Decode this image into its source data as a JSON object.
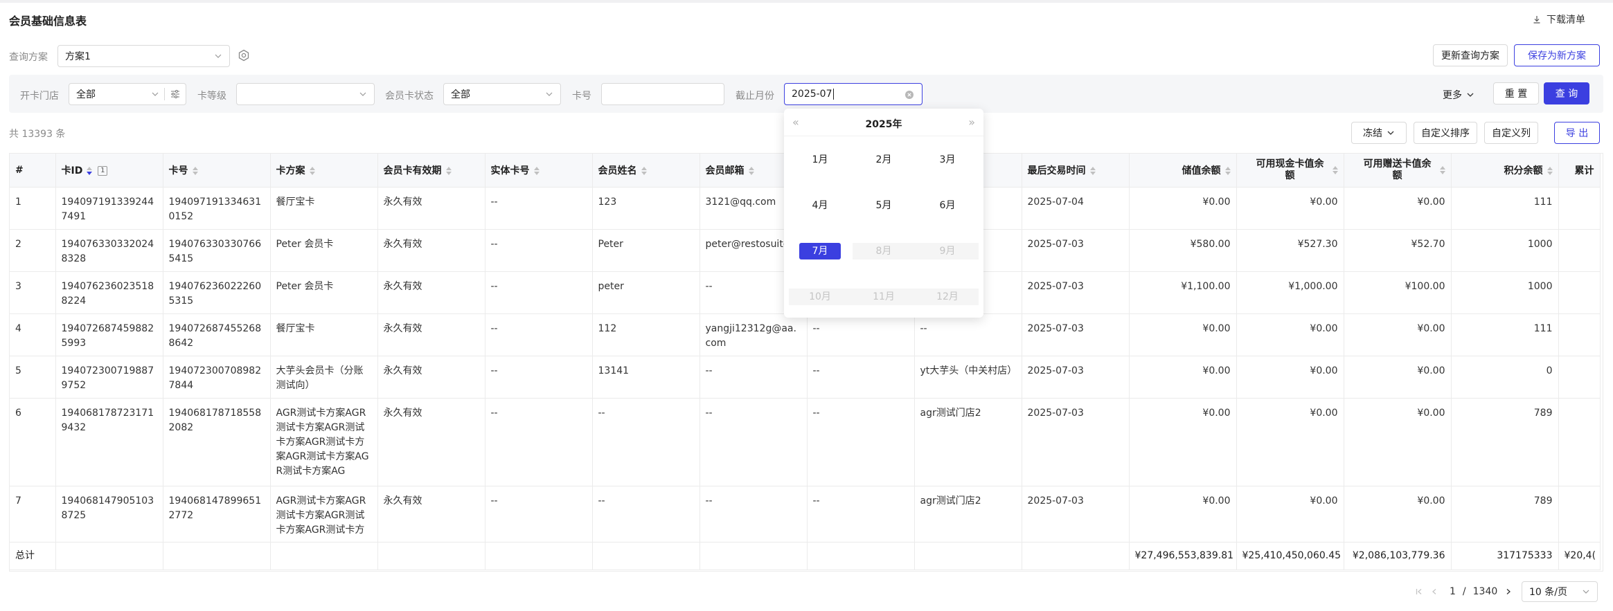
{
  "header": {
    "title": "会员基础信息表",
    "download_label": "下载清单"
  },
  "scheme": {
    "label": "查询方案",
    "value": "方案1",
    "update_label": "更新查询方案",
    "save_new_label": "保存为新方案"
  },
  "filters": {
    "store_label": "开卡门店",
    "store_value": "全部",
    "level_label": "卡等级",
    "level_value": "",
    "status_label": "会员卡状态",
    "status_value": "全部",
    "card_no_label": "卡号",
    "card_no_value": "",
    "month_label": "截止月份",
    "month_value": "2025-07",
    "more_label": "更多",
    "reset_label": "重 置",
    "query_label": "查 询"
  },
  "datepicker": {
    "year": "2025年",
    "months": [
      "1月",
      "2月",
      "3月",
      "4月",
      "5月",
      "6月",
      "7月",
      "8月",
      "9月",
      "10月",
      "11月",
      "12月"
    ],
    "selected": "7月"
  },
  "toolbar": {
    "total_text": "共 13393 条",
    "freeze_label": "冻结",
    "custom_sort_label": "自定义排序",
    "custom_cols_label": "自定义列",
    "export_label": "导 出"
  },
  "table": {
    "columns": [
      "#",
      "卡ID",
      "卡号",
      "卡方案",
      "会员卡有效期",
      "实体卡号",
      "会员姓名",
      "会员邮箱",
      "",
      "",
      "最后交易时间",
      "储值余额",
      "可用现金卡值余额",
      "可用赠送卡值余额",
      "积分余额",
      "累计"
    ],
    "sort_badge": "1",
    "rows": [
      [
        "1",
        "1940971913392447491",
        "1940971913346310152",
        "餐厅宝卡",
        "永久有效",
        "--",
        "123",
        "3121@qq.com",
        "",
        "",
        "2025-07-04",
        "¥0.00",
        "¥0.00",
        "¥0.00",
        "111",
        ""
      ],
      [
        "2",
        "1940763303320248328",
        "1940763303307665415",
        "Peter 会员卡",
        "永久有效",
        "--",
        "Peter",
        "peter@restosuite.ai",
        "",
        "",
        "2025-07-03",
        "¥580.00",
        "¥527.30",
        "¥52.70",
        "1000",
        ""
      ],
      [
        "3",
        "1940762360235188224",
        "1940762360222605315",
        "Peter 会员卡",
        "永久有效",
        "--",
        "peter",
        "--",
        "",
        "",
        "2025-07-03",
        "¥1,100.00",
        "¥1,000.00",
        "¥100.00",
        "1000",
        ""
      ],
      [
        "4",
        "1940726874598825993",
        "1940726874552688642",
        "餐厅宝卡",
        "永久有效",
        "--",
        "112",
        "yangji12312g@aa.com",
        "--",
        "--",
        "2025-07-03",
        "¥0.00",
        "¥0.00",
        "¥0.00",
        "111",
        ""
      ],
      [
        "5",
        "1940723007198879752",
        "1940723007089827844",
        "大芋头会员卡（分账测试向）",
        "永久有效",
        "--",
        "13141",
        "--",
        "--",
        "yt大芋头（中关村店）",
        "2025-07-03",
        "¥0.00",
        "¥0.00",
        "¥0.00",
        "0",
        ""
      ],
      [
        "6",
        "1940681787231719432",
        "1940681787185582082",
        "AGR测试卡方案AGR测试卡方案AGR测试卡方案AGR测试卡方案AGR测试卡方案AGR测试卡方案AG",
        "永久有效",
        "--",
        "--",
        "--",
        "--",
        "agr测试门店2",
        "2025-07-03",
        "¥0.00",
        "¥0.00",
        "¥0.00",
        "789",
        ""
      ],
      [
        "7",
        "1940681479051038725",
        "1940681478996512772",
        "AGR测试卡方案AGR测试卡方案AGR测试卡方案AGR测试卡方",
        "永久有效",
        "--",
        "--",
        "--",
        "--",
        "agr测试门店2",
        "2025-07-03",
        "¥0.00",
        "¥0.00",
        "¥0.00",
        "789",
        ""
      ]
    ],
    "total_row": [
      "总计",
      "",
      "",
      "",
      "",
      "",
      "",
      "",
      "",
      "",
      "",
      "¥27,496,553,839.81",
      "¥25,410,450,060.45",
      "¥2,086,103,779.36",
      "317175333",
      "¥20,4("
    ]
  },
  "pagination": {
    "current": "1",
    "separator": "/",
    "total_pages": "1340",
    "page_size": "10 条/页"
  },
  "colors": {
    "primary": "#3b3fe0",
    "header_bg": "#f7f8fa",
    "filter_bg": "#f5f6f8"
  }
}
